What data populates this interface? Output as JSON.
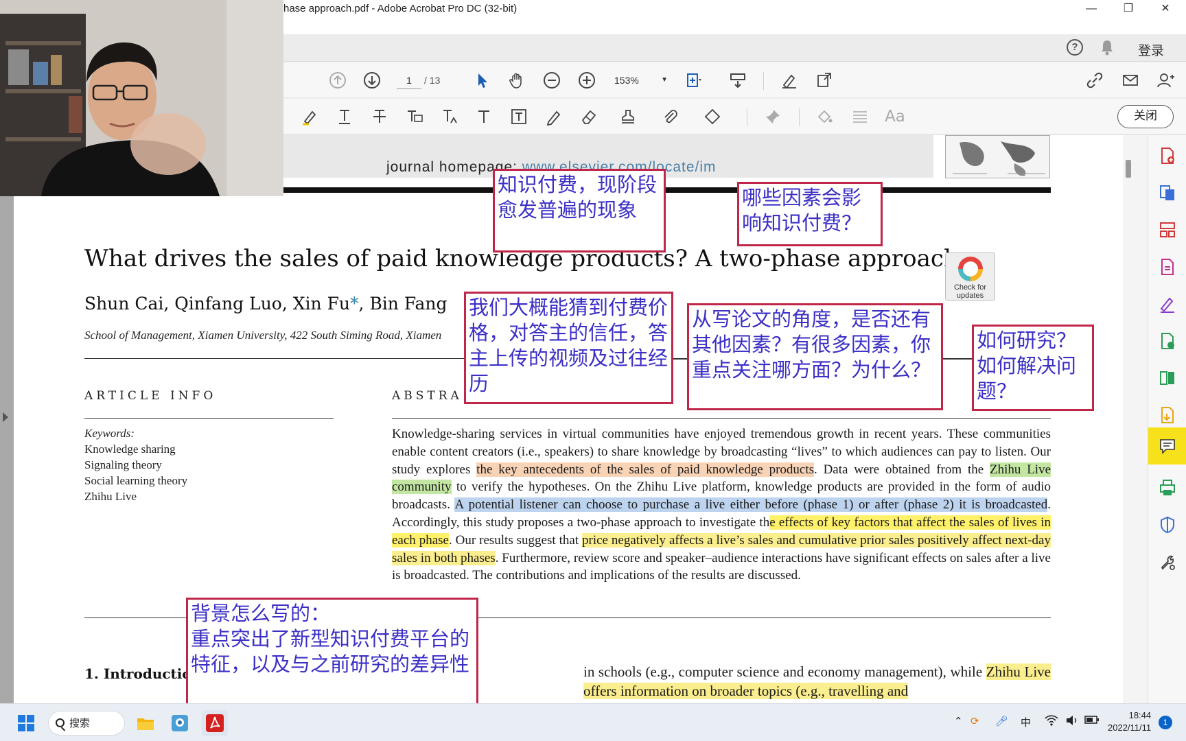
{
  "window": {
    "title": "hase approach.pdf - Adobe Acrobat Pro DC (32-bit)",
    "login_label": "登录"
  },
  "toolbar": {
    "page_current": "1",
    "page_total": "/ 13",
    "zoom": "153%",
    "close_label": "关闭"
  },
  "doc": {
    "journal_prefix": "journal homepage: ",
    "journal_url": "www.elsevier.com/locate/im",
    "title": "What drives the sales of paid knowledge products? A two-phase approach",
    "authors_main": "Shun Cai, Qinfang Luo, Xin Fu",
    "authors_ast": "*",
    "authors_end": ", Bin Fang",
    "affiliation": "School of Management, Xiamen University, 422 South Siming Road, Xiamen",
    "check_label_1": "Check for",
    "check_label_2": "updates",
    "article_info": "ARTICLE INFO",
    "abstract_head": "ABSTRA",
    "keywords_label": "Keywords:",
    "keywords": [
      "Knowledge sharing",
      "Signaling theory",
      "Social learning theory",
      "Zhihu Live"
    ],
    "abstract": {
      "p1": "Knowledge-sharing services in virtual communities have enjoyed tremendous growth in recent years. These communities enable content creators (i.e., speakers) to share knowledge by broadcasting “lives” to which audiences can pay to listen. Our study explores ",
      "h_orange": "the key antecedents of the sales of paid knowledge products",
      "p2": ". Data were obtained from the ",
      "h_green": "Zhihu Live community",
      "p3": " to verify the hypotheses. On the Zhihu Live platform, knowledge products are provided in the form of audio broadcasts. ",
      "h_blue": "A potential listener can choose to purchase a live either before (phase 1) or after (phase 2) it is broadcasted",
      "p4": ". Accordingly, this study proposes a two-phase approach to investigate th",
      "h_yellow": "e effects of key factors that affect the sales of lives in each phase",
      "p5": ". Our results suggest that ",
      "h_yellow2": "price negatively affects a live’s sales and cumulative prior sales positively affect next-day sales in both phases",
      "p6": ". Furthermore, review score and speaker–audience interactions have significant effects on sales after a live is broadcasted. The contributions and implications of the results are discussed."
    },
    "intro_head": "1.  Introductio",
    "intro_right_1": "in schools (e.g., computer science and economy management), while ",
    "intro_right_hl": "Zhihu Live offers information on broader topics (e.g., travelling and"
  },
  "annotations": [
    "知识付费，现阶段愈发普遍的现象",
    "哪些因素会影响知识付费？",
    "我们大概能猜到付费价格，对答主的信任，答主上传的视频及过往经历",
    "从写论文的角度，是否还有其他因素？有很多因素，你重点关注哪方面？为什么？",
    "如何研究？如何解决问题？",
    "背景怎么写的：\n重点突出了新型知识付费平台的特征，以及与之前研究的差异性"
  ],
  "taskbar": {
    "search_label": "搜索",
    "ime": "中",
    "time": "18:44",
    "date": "2022/11/11",
    "notif_count": "1"
  },
  "colors": {
    "annotation_border": "#c0254a",
    "annotation_text": "#3b2fc6",
    "comment_active": "#f7e11a"
  }
}
